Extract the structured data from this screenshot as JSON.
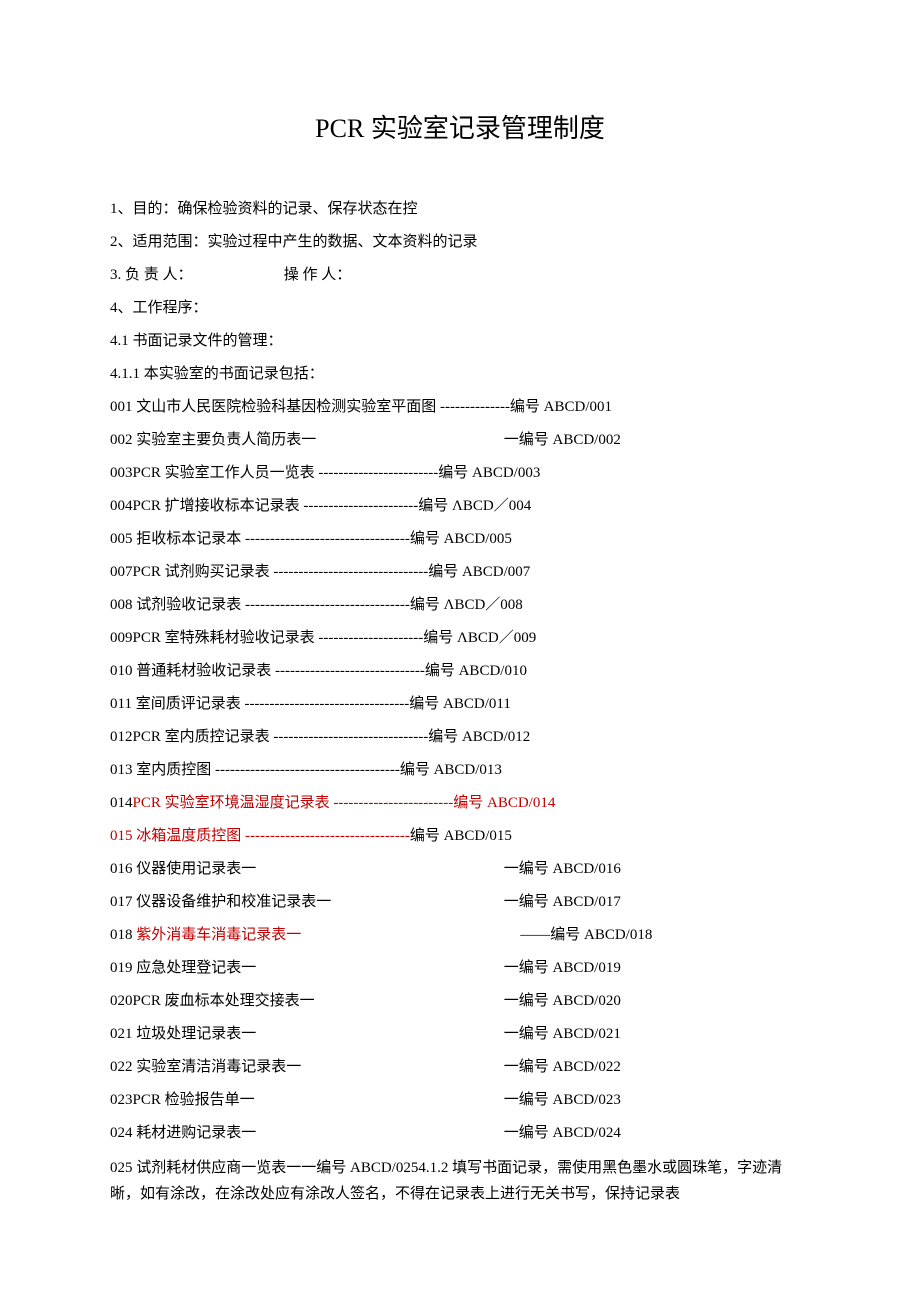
{
  "title": "PCR 实验室记录管理制度",
  "lines": {
    "l1": "1、目的：确保检验资料的记录、保存状态在控",
    "l2": "2、适用范围：实验过程中产生的数据、文本资料的记录",
    "l3a": "3. 负 责 人：",
    "l3b": "操 作 人：",
    "l4": "4、工作程序：",
    "l41": "4.1 书面记录文件的管理：",
    "l411": "4.1.1 本实验室的书面记录包括：",
    "d001": "001 文山市人民医院检验科基因检测实验室平面图 --------------编号 ABCD/001",
    "d002": "002 实验室主要负责人简历表一",
    "d002b": "一编号 ABCD/002",
    "d003": "003PCR 实验室工作人员一览表 ------------------------编号 ABCD/003",
    "d004": "004PCR 扩增接收标本记录表 -----------------------编号 ΛBCD／004",
    "d005": "005 拒收标本记录本 ---------------------------------编号 ABCD/005",
    "d007": "007PCR 试剂购买记录表 -------------------------------编号 ABCD/007",
    "d008": "008 试剂验收记录表 ---------------------------------编号 ΛBCD／008",
    "d009": "009PCR 室特殊耗材验收记录表 ---------------------编号 ΛBCD／009",
    "d010": "010 普通耗材验收记录表 ------------------------------编号 ABCD/010",
    "d011": "011 室间质评记录表 ---------------------------------编号 ABCD/011",
    "d012": "012PCR 室内质控记录表 -------------------------------编号 ABCD/012",
    "d013": "013 室内质控图 -------------------------------------编号 ABCD/013",
    "d014a": "014",
    "d014b": "PCR 实验室环境温湿度记录表 ------------------------编号 ABCD/014",
    "d015a": "015 冰箱温度质控图 ---------------------------------",
    "d015b": "编号 ABCD/015",
    "d016a": "016 仪器使用记录表一",
    "d016b": "一编号 ABCD/016",
    "d017a": "017 仪器设备维护和校准记录表一",
    "d017b": "一编号 ABCD/017",
    "d018a": "018 ",
    "d018b": "紫外消毒车消毒记录表一",
    "d018c": "——编号 ABCD/018",
    "d019a": "019 应急处理登记表一",
    "d019b": "一编号 ABCD/019",
    "d020a": "020PCR 废血标本处理交接表一",
    "d020b": "一编号 ABCD/020",
    "d021a": "021 垃圾处理记录表一",
    "d021b": "一编号 ABCD/021",
    "d022a": "022 实验室清洁消毒记录表一",
    "d022b": "一编号 ABCD/022",
    "d023a": "023PCR 检验报告单一",
    "d023b": "一编号 ABCD/023",
    "d024a": "024 耗材进购记录表一",
    "d024b": "一编号 ABCD/024",
    "para": "025 试剂耗材供应商一览表一一编号 ABCD/0254.1.2 填写书面记录，需使用黑色墨水或圆珠笔，字迹清晰，如有涂改，在涂改处应有涂改人签名，不得在记录表上进行无关书写，保持记录表"
  }
}
